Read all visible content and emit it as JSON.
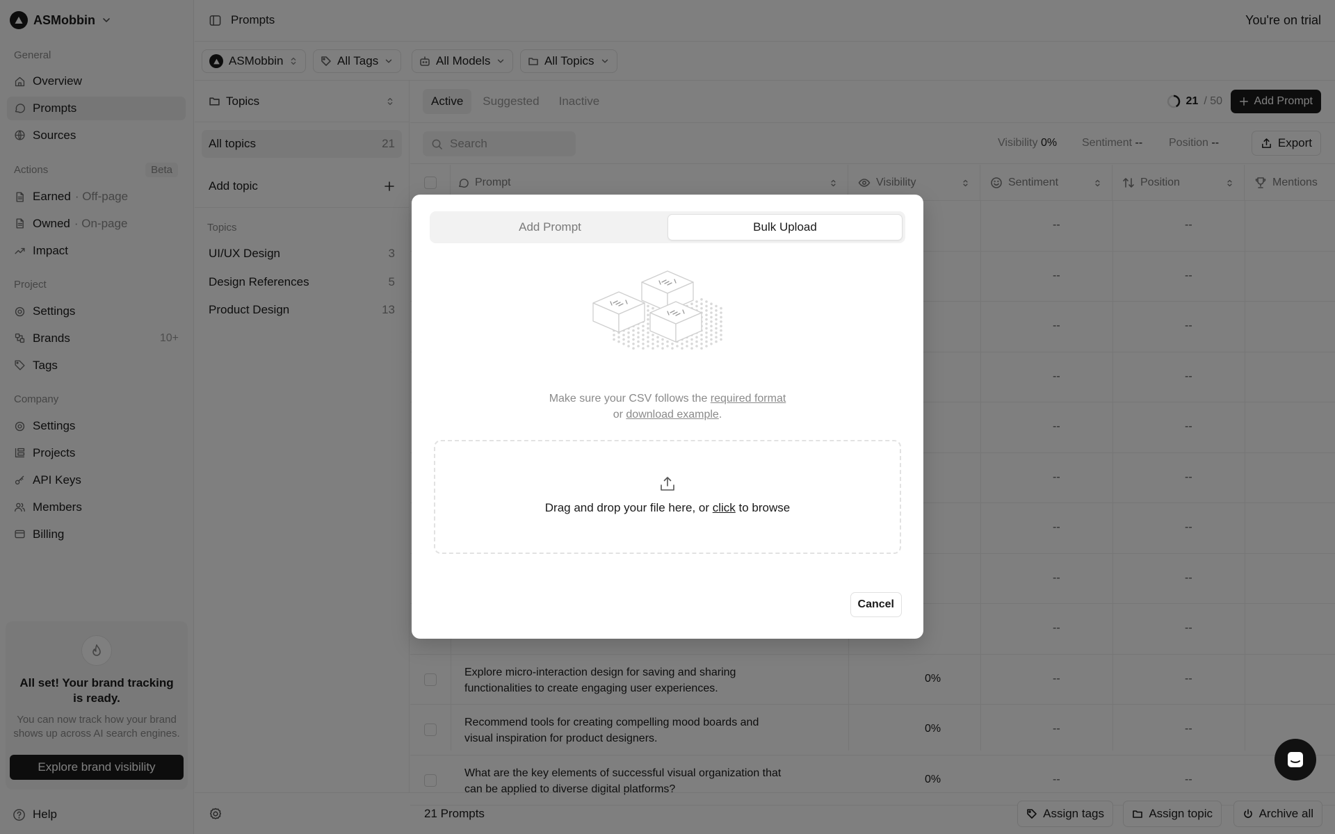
{
  "workspace": {
    "name": "ASMobbin"
  },
  "sidebar": {
    "sections": {
      "general": "General",
      "actions": "Actions",
      "beta": "Beta",
      "project": "Project",
      "company": "Company"
    },
    "general": [
      {
        "label": "Overview",
        "icon": "home-icon"
      },
      {
        "label": "Prompts",
        "icon": "chat-bubble-icon"
      },
      {
        "label": "Sources",
        "icon": "globe-icon"
      }
    ],
    "actions": [
      {
        "label": "Earned",
        "sub": "· Off-page",
        "icon": "file-icon"
      },
      {
        "label": "Owned",
        "sub": "· On-page",
        "icon": "file-icon"
      },
      {
        "label": "Impact",
        "sub": "",
        "icon": "trend-up-icon"
      }
    ],
    "project": [
      {
        "label": "Settings",
        "icon": "gear-icon",
        "count": ""
      },
      {
        "label": "Brands",
        "icon": "brands-icon",
        "count": "10+"
      },
      {
        "label": "Tags",
        "icon": "tag-icon",
        "count": ""
      }
    ],
    "company": [
      {
        "label": "Settings",
        "icon": "gear-icon"
      },
      {
        "label": "Projects",
        "icon": "projects-icon"
      },
      {
        "label": "API Keys",
        "icon": "key-icon"
      },
      {
        "label": "Members",
        "icon": "users-icon"
      },
      {
        "label": "Billing",
        "icon": "card-icon"
      }
    ],
    "promo": {
      "title": "All set! Your brand tracking is ready.",
      "text": "You can now track how your brand shows up across AI search engines.",
      "button": "Explore brand visibility"
    },
    "help": "Help"
  },
  "header": {
    "title": "Prompts",
    "trial": "You're on trial"
  },
  "filters": {
    "brand": "ASMobbin",
    "tags": "All Tags",
    "models": "All Models",
    "topics": "All Topics"
  },
  "topics_panel": {
    "header": "Topics",
    "all_label": "All topics",
    "all_count": "21",
    "add_label": "Add topic",
    "section_label": "Topics",
    "items": [
      {
        "label": "UI/UX Design",
        "count": "3"
      },
      {
        "label": "Design References",
        "count": "5"
      },
      {
        "label": "Product Design",
        "count": "13"
      }
    ]
  },
  "main": {
    "tabs": [
      "Active",
      "Suggested",
      "Inactive"
    ],
    "quota": {
      "used": "21",
      "total": "/ 50"
    },
    "add_prompt": "Add Prompt",
    "search_placeholder": "Search",
    "metrics": {
      "visibility_label": "Visibility",
      "visibility_value": "0%",
      "sentiment_label": "Sentiment",
      "sentiment_value": "--",
      "position_label": "Position",
      "position_value": "--"
    },
    "export": "Export",
    "columns": {
      "prompt": "Prompt",
      "visibility": "Visibility",
      "sentiment": "Sentiment",
      "position": "Position",
      "mentions": "Mentions"
    },
    "rows": [
      {
        "prompt": "",
        "visibility": "",
        "sentiment": "--",
        "position": "--"
      },
      {
        "prompt": "",
        "visibility": "",
        "sentiment": "--",
        "position": "--"
      },
      {
        "prompt": "",
        "visibility": "",
        "sentiment": "--",
        "position": "--"
      },
      {
        "prompt": "",
        "visibility": "",
        "sentiment": "--",
        "position": "--"
      },
      {
        "prompt": "",
        "visibility": "",
        "sentiment": "--",
        "position": "--"
      },
      {
        "prompt": "",
        "visibility": "",
        "sentiment": "--",
        "position": "--"
      },
      {
        "prompt": "",
        "visibility": "",
        "sentiment": "--",
        "position": "--"
      },
      {
        "prompt": "",
        "visibility": "",
        "sentiment": "--",
        "position": "--"
      },
      {
        "prompt": "",
        "visibility": "",
        "sentiment": "--",
        "position": "--"
      },
      {
        "prompt": "Explore micro-interaction design for saving and sharing functionalities to create engaging user experiences.",
        "visibility": "0%",
        "sentiment": "--",
        "position": "--"
      },
      {
        "prompt": "Recommend tools for creating compelling mood boards and visual inspiration for product designers.",
        "visibility": "0%",
        "sentiment": "--",
        "position": "--"
      },
      {
        "prompt": "What are the key elements of successful visual organization that can be applied to diverse digital platforms?",
        "visibility": "0%",
        "sentiment": "--",
        "position": "--"
      }
    ]
  },
  "footer": {
    "count": "21 Prompts",
    "assign_tags": "Assign tags",
    "assign_topic": "Assign topic",
    "archive_all": "Archive all"
  },
  "modal": {
    "tab_add": "Add Prompt",
    "tab_bulk": "Bulk Upload",
    "hint_prefix": "Make sure your CSV follows the ",
    "required_format": "required format",
    "hint_or": "or ",
    "download_example": "download example",
    "hint_end": ".",
    "drop_prefix": "Drag and drop your file here, or ",
    "drop_click": "click",
    "drop_suffix": " to browse",
    "cancel": "Cancel"
  }
}
